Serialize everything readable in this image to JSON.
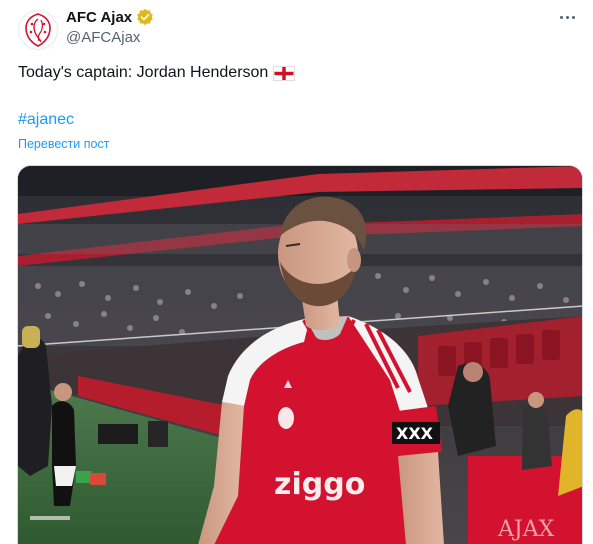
{
  "author": {
    "display_name": "AFC Ajax",
    "handle": "@AFCAjax",
    "avatar_icon": "ajax-crest-icon",
    "verified_icon": "verified-gold-badge-icon"
  },
  "tweet": {
    "text": "Today's captain: Jordan Henderson",
    "flag_icon": "england-flag-icon",
    "hashtag": "#ajanec",
    "translate_label": "Перевести пост"
  },
  "menu": {
    "more_icon": "more-options-icon"
  },
  "media": {
    "description_icon": "photo",
    "jersey_text": "ziggo",
    "armband_text": "XXX"
  },
  "colors": {
    "link": "#1d9bf0",
    "secondary_text": "#536471",
    "verified_gold": "#e2b719",
    "ajax_red": "#d2122e"
  }
}
